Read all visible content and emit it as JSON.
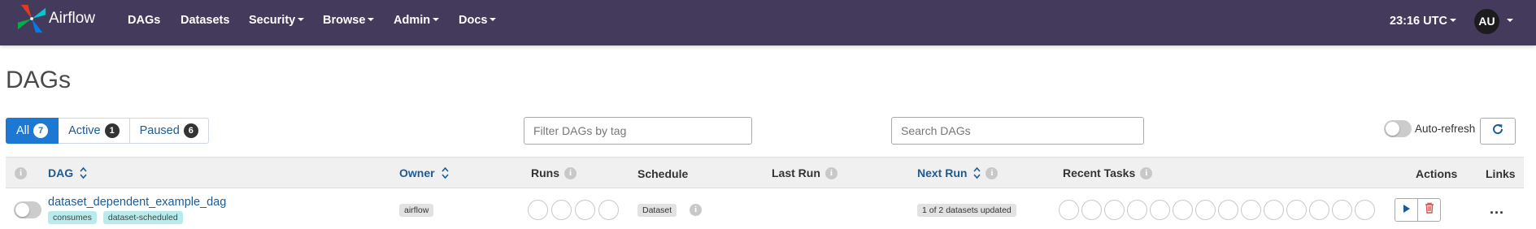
{
  "app": {
    "brand": "Airflow",
    "nav": [
      {
        "label": "DAGs",
        "dropdown": false
      },
      {
        "label": "Datasets",
        "dropdown": false
      },
      {
        "label": "Security",
        "dropdown": true
      },
      {
        "label": "Browse",
        "dropdown": true
      },
      {
        "label": "Admin",
        "dropdown": true
      },
      {
        "label": "Docs",
        "dropdown": true
      }
    ],
    "clock": "23:16 UTC",
    "user_initials": "AU"
  },
  "page": {
    "title": "DAGs"
  },
  "filters": {
    "all": {
      "label": "All",
      "count": "7"
    },
    "active": {
      "label": "Active",
      "count": "1"
    },
    "paused": {
      "label": "Paused",
      "count": "6"
    }
  },
  "tag_filter": {
    "placeholder": "Filter DAGs by tag"
  },
  "search": {
    "placeholder": "Search DAGs"
  },
  "auto_refresh": {
    "label": "Auto-refresh",
    "enabled": false
  },
  "table": {
    "columns": {
      "dag": "DAG",
      "owner": "Owner",
      "runs": "Runs",
      "schedule": "Schedule",
      "last_run": "Last Run",
      "next_run": "Next Run",
      "recent_tasks": "Recent Tasks",
      "actions": "Actions",
      "links": "Links"
    },
    "rows": [
      {
        "dag_id": "dataset_dependent_example_dag",
        "tags": [
          "consumes",
          "dataset-scheduled"
        ],
        "owner": "airflow",
        "schedule": "Dataset",
        "next_run": "1 of 2 datasets updated",
        "paused": true,
        "runs_circles": 4,
        "task_circles": 14,
        "links_label": "..."
      }
    ]
  },
  "colors": {
    "navbar": "#443b5c",
    "accent": "#1c78d3",
    "link": "#1c5b94",
    "delete": "#d9534f",
    "tag": "#b8ecec"
  }
}
